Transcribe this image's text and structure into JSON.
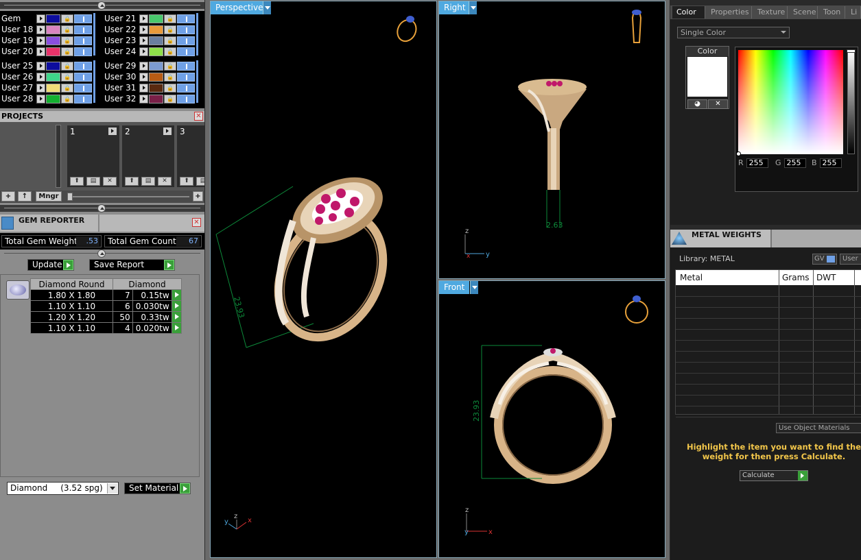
{
  "layers": {
    "left": [
      {
        "name": "Gem",
        "color": "#0d0d9e"
      },
      {
        "name": "User 18",
        "color": "#d985c0"
      },
      {
        "name": "User 19",
        "color": "#8a4fe0"
      },
      {
        "name": "User 20",
        "color": "#e8336a"
      },
      {
        "name": "User 25",
        "color": "#0d0d9e"
      },
      {
        "name": "User 26",
        "color": "#3fd68a"
      },
      {
        "name": "User 27",
        "color": "#f0dc78"
      },
      {
        "name": "User 28",
        "color": "#14b030"
      }
    ],
    "right": [
      {
        "name": "User 21",
        "color": "#49c76c"
      },
      {
        "name": "User 22",
        "color": "#e89a3a"
      },
      {
        "name": "User 23",
        "color": "#6a7fa0"
      },
      {
        "name": "User 24",
        "color": "#8fe04a"
      },
      {
        "name": "User 29",
        "color": "#7c9bd0"
      },
      {
        "name": "User 30",
        "color": "#b85c14"
      },
      {
        "name": "User 31",
        "color": "#5a2a10"
      },
      {
        "name": "User 32",
        "color": "#7a2048"
      }
    ]
  },
  "projects": {
    "title": "PROJECTS",
    "slots": [
      "1",
      "2",
      "3"
    ],
    "mngr_label": "Mngr",
    "add": "+",
    "up": "↑"
  },
  "gem_reporter": {
    "title": "GEM REPORTER",
    "total_weight_label": "Total Gem Weight",
    "total_weight_value": ".53",
    "total_count_label": "Total Gem Count",
    "total_count_value": "67",
    "update_label": "Update",
    "save_report_label": "Save Report",
    "table_headers": [
      "Diamond Round",
      "Diamond"
    ],
    "rows": [
      {
        "size": "1.80 X 1.80",
        "count": "7",
        "weight": "0.15tw"
      },
      {
        "size": "1.10 X 1.10",
        "count": "6",
        "weight": "0.030tw"
      },
      {
        "size": "1.20 X 1.20",
        "count": "50",
        "weight": "0.33tw"
      },
      {
        "size": "1.10 X 1.10",
        "count": "4",
        "weight": "0.020tw"
      }
    ],
    "material_select": "Diamond     (3.52 spg)",
    "set_material_label": "Set Material"
  },
  "viewports": {
    "perspective": {
      "label": "Perspective",
      "dimension": "23.93"
    },
    "right": {
      "label": "Right",
      "dimension": "2.63"
    },
    "front": {
      "label": "Front",
      "dimension": "23.93"
    },
    "axis_x": "x",
    "axis_y": "y",
    "axis_z": "z"
  },
  "right_panel": {
    "tabs": [
      "Color",
      "Properties",
      "Texture",
      "Scene",
      "Toon",
      "Li"
    ],
    "color_mode": "Single Color",
    "color_label": "Color",
    "r_label": "R",
    "g_label": "G",
    "b_label": "B",
    "r": "255",
    "g": "255",
    "b": "255",
    "swatch_color": "#ffffff"
  },
  "metal_weights": {
    "title": "METAL WEIGHTS",
    "library": "Library: METAL",
    "gv_label": "GV",
    "user_label": "User",
    "columns": [
      "Metal",
      "Grams",
      "DWT"
    ],
    "use_object_materials": "Use Object Materials",
    "hint": "Highlight the item you want to find the weight for then press Calculate.",
    "calculate_label": "Calculate"
  }
}
